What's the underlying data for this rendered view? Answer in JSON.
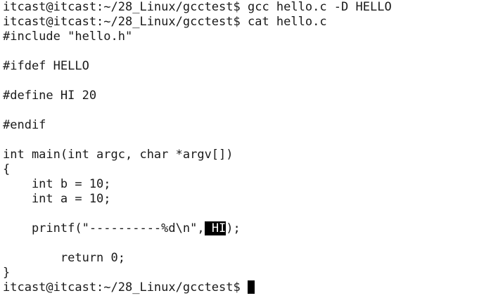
{
  "terminal": {
    "colors": {
      "background": "#ffffff",
      "foreground": "#1a1a1a",
      "highlight_bg": "#000000",
      "highlight_fg": "#ffffff",
      "cursor": "#000000"
    },
    "lines": [
      "itcast@itcast:~/28_Linux/gcctest$ gcc hello.c -D HELLO",
      "itcast@itcast:~/28_Linux/gcctest$ cat hello.c",
      "#include \"hello.h\"",
      "",
      "#ifdef HELLO",
      "",
      "#define HI 20",
      "",
      "#endif",
      "",
      "int main(int argc, char *argv[])",
      "{",
      "    int b = 10;",
      "    int a = 10;",
      "",
      "    printf(\"----------%d\\n\",",
      "",
      "        return 0;",
      "}",
      "itcast@itcast:~/28_Linux/gcctest$ "
    ],
    "printf_highlight": " HI",
    "printf_tail": ");"
  }
}
